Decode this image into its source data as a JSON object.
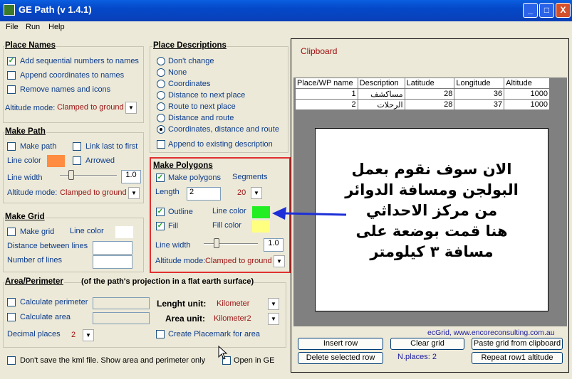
{
  "window": {
    "title": "GE Path (v 1.4.1)",
    "min": "_",
    "max": "□",
    "close": "X"
  },
  "menu": [
    "File",
    "Run",
    "Help"
  ],
  "place_names": {
    "title": "Place Names",
    "add_seq": "Add sequential numbers to names",
    "append_coords": "Append coordinates to names",
    "remove_names": "Remove names and icons",
    "alt_label": "Altitude mode:",
    "alt_value": "Clamped to ground"
  },
  "make_path": {
    "title": "Make Path",
    "make_path": "Make path",
    "link_last": "Link last to first",
    "line_color": "Line color",
    "arrowed": "Arrowed",
    "line_width": "Line width",
    "width_value": "1.0",
    "alt_label": "Altitude mode:",
    "alt_value": "Clamped to ground",
    "line_color_hex": "#ff8c40"
  },
  "make_grid": {
    "title": "Make Grid",
    "make_grid": "Make grid",
    "line_color": "Line color",
    "distance": "Distance between lines",
    "number": "Number of  lines"
  },
  "place_desc": {
    "title": "Place Descriptions",
    "options": [
      "Don't change",
      "None",
      "Coordinates",
      "Distance to next place",
      "Route to next place",
      "Distance and route",
      "Coordinates, distance and route"
    ],
    "selected": 6,
    "append": "Append to existing description"
  },
  "polygons": {
    "title": "Make Polygons",
    "make_polygons": "Make polygons",
    "segments_label": "Segments",
    "length_label": "Length",
    "length_value": "2",
    "segments_value": "20",
    "outline": "Outline",
    "line_color": "Line color",
    "fill": "Fill",
    "fill_color": "Fill color",
    "line_width": "Line width",
    "width_value": "1.0",
    "alt_label": "Altitude mode:",
    "alt_value": "Clamped to ground",
    "line_color_hex": "#22ee22",
    "fill_color_hex": "#ffff80"
  },
  "area": {
    "title": "Area/Perimeter",
    "subtitle": "(of the path's projection in a flat earth surface)",
    "calc_perimeter": "Calculate perimeter",
    "calc_area": "Calculate area",
    "length_unit_label": "Lenght unit:",
    "length_unit": "Kilometer",
    "area_unit_label": "Area unit:",
    "area_unit": "Kilometer2",
    "decimal_label": "Decimal places",
    "decimal_value": "2",
    "create_placemark": "Create Placemark for area"
  },
  "bottom": {
    "dont_save": "Don't save the kml file. Show area and perimeter only",
    "open_ge": "Open in GE"
  },
  "clipboard": {
    "title": "Clipboard",
    "headers": [
      "Place/WP name",
      "Description",
      "Latitude",
      "Longitude",
      "Altitude"
    ],
    "rows": [
      [
        "1",
        "مساكشف",
        "28",
        "36",
        "1000"
      ],
      [
        "2",
        "الرحلات",
        "28",
        "37",
        "1000"
      ]
    ]
  },
  "annotation": {
    "lines": [
      "الان سوف نقوم بعمل",
      "البولجن ومسافة الدوائر",
      "من مركز الاحداثي",
      "هنا قمت بوضعة على",
      "مسافة ٣ كيلومتر"
    ]
  },
  "credit": "ecGrid,  www.encoreconsulting.com.au",
  "buttons": {
    "insert": "Insert row",
    "clear": "Clear grid",
    "paste": "Paste grid from clipboard",
    "delete": "Delete selected row",
    "nplaces": "N.places: 2",
    "repeat": "Repeat row1 altitude"
  }
}
